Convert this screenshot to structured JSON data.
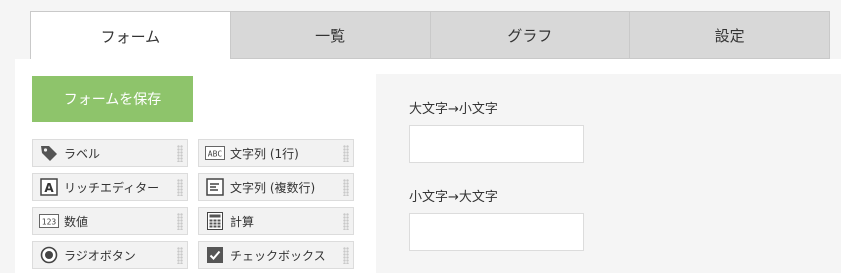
{
  "tabs": [
    {
      "label": "フォーム",
      "active": true
    },
    {
      "label": "一覧",
      "active": false
    },
    {
      "label": "グラフ",
      "active": false
    },
    {
      "label": "設定",
      "active": false
    }
  ],
  "save_button": {
    "label": "フォームを保存",
    "color": "#8ec46b"
  },
  "palette": [
    {
      "label": "ラベル",
      "icon": "tag-icon"
    },
    {
      "label": "文字列 (1行)",
      "icon": "text-abc-icon"
    },
    {
      "label": "リッチエディター",
      "icon": "rich-editor-icon"
    },
    {
      "label": "文字列 (複数行)",
      "icon": "multiline-text-icon"
    },
    {
      "label": "数値",
      "icon": "number-icon"
    },
    {
      "label": "計算",
      "icon": "calculator-icon"
    },
    {
      "label": "ラジオボタン",
      "icon": "radio-icon"
    },
    {
      "label": "チェックボックス",
      "icon": "checkbox-icon"
    }
  ],
  "preview": {
    "fields": [
      {
        "label": "大文字→小文字",
        "value": ""
      },
      {
        "label": "小文字→大文字",
        "value": ""
      }
    ]
  }
}
